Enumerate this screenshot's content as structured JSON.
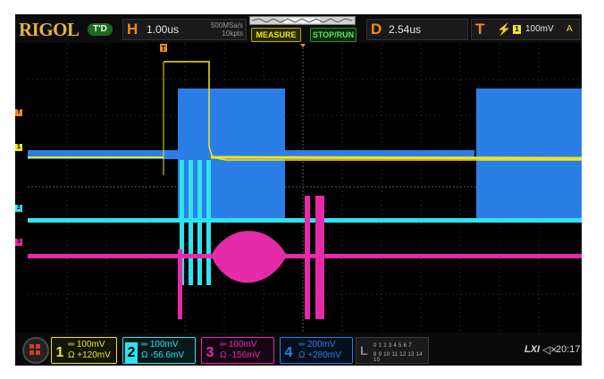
{
  "brand": "RIGOL",
  "run_state": "T'D",
  "horizontal": {
    "key": "H",
    "timebase": "1.00us",
    "sample_rate": "500MSa/s",
    "memory_depth": "10kpts"
  },
  "buttons": {
    "measure": "MEASURE",
    "stop_run": "STOP/RUN"
  },
  "delay": {
    "key": "D",
    "value": "2.54us"
  },
  "trigger": {
    "key": "T",
    "source_num": "1",
    "level": "100mV",
    "mode": "A"
  },
  "markers": {
    "trigger": "T",
    "ch1": "1",
    "ch2": "2",
    "ch3": "3"
  },
  "channels": [
    {
      "num": "1",
      "scale": "100mV",
      "coupling": "Ω",
      "offset": "+120mV",
      "color": "#f2e41e"
    },
    {
      "num": "2",
      "scale": "100mV",
      "coupling": "Ω",
      "offset": "-56.6mV",
      "color": "#2fe3ee"
    },
    {
      "num": "3",
      "scale": "100mV",
      "coupling": "Ω",
      "offset": "-156mV",
      "color": "#e62aa8"
    },
    {
      "num": "4",
      "scale": "200mV",
      "coupling": "Ω",
      "offset": "+280mV",
      "color": "#2b7ee6"
    }
  ],
  "logic": {
    "key": "L",
    "row1": "0 1 2 3   4 5 6 7",
    "row2": "8 9 10 11  12 13 14 15"
  },
  "status": {
    "lxi": "LXI",
    "speaker": "◁×",
    "time": "20:17"
  },
  "colors": {
    "accent": "#f28a1e",
    "ch1": "#f2e41e",
    "ch2": "#2fe3ee",
    "ch3": "#e62aa8",
    "ch4": "#2b7ee6"
  }
}
